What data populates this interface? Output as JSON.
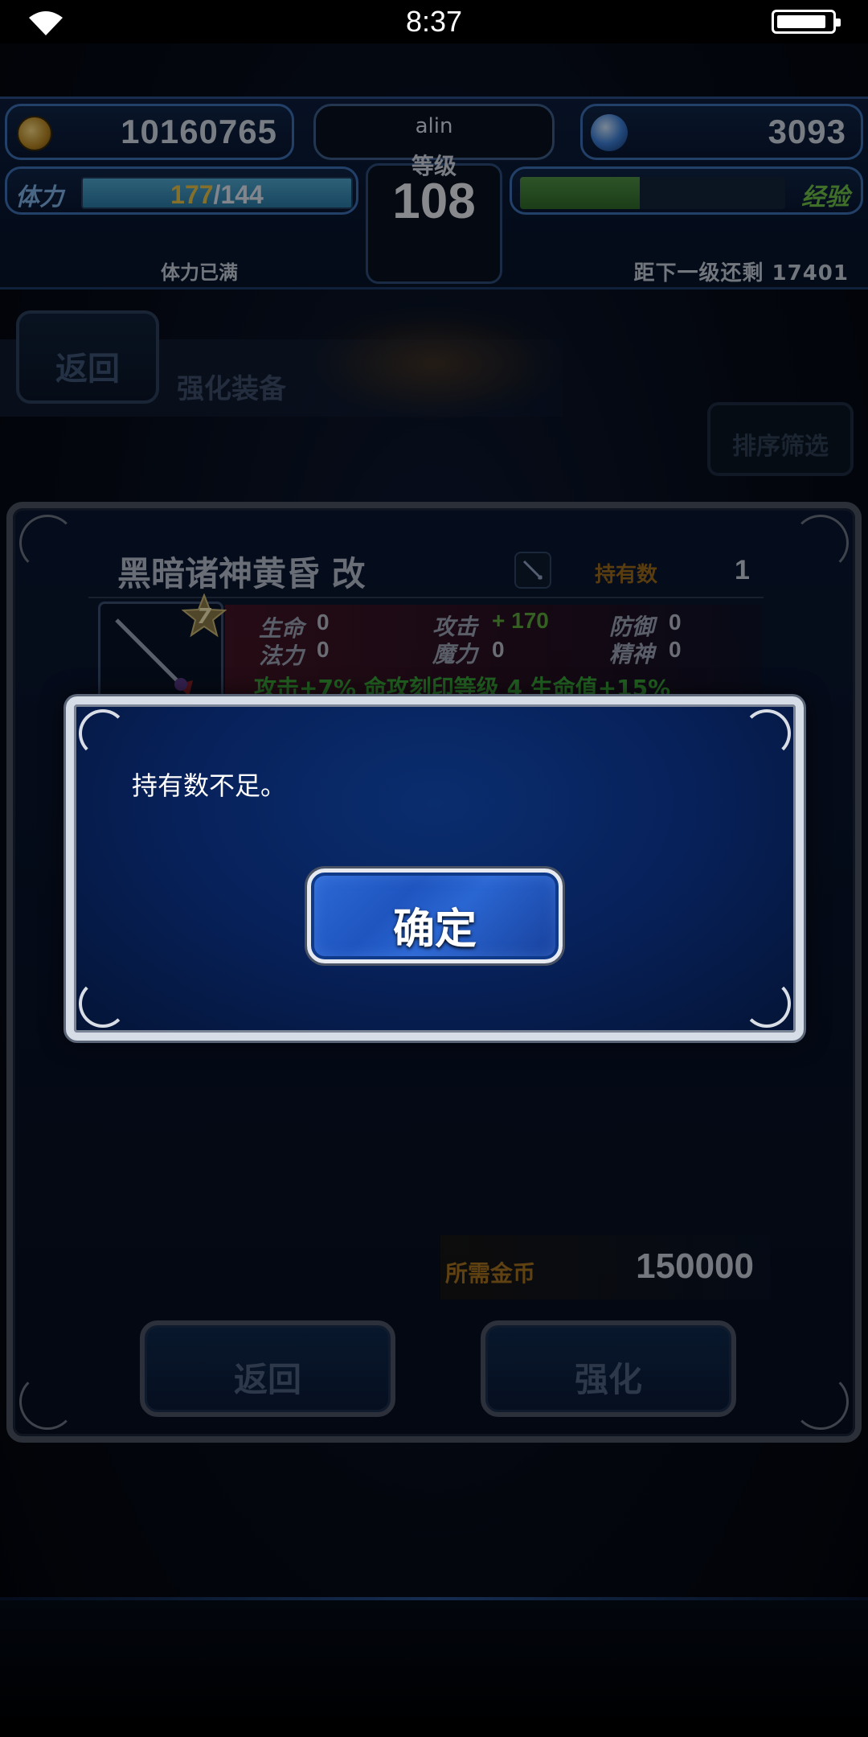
{
  "status_bar": {
    "time": "8:37"
  },
  "hud": {
    "gold": "10160765",
    "gems": "3093",
    "player_name": "alin",
    "level_label": "等级",
    "level": "108",
    "stamina_label": "体力",
    "stamina_current": "177",
    "stamina_max": "/144",
    "stamina_note": "体力已满",
    "exp_label": "经验",
    "exp_progress": 0.45,
    "exp_note": "距下一级还剩 17401"
  },
  "header": {
    "back_label": "返回",
    "title": "强化装备",
    "sort_label": "排序筛选"
  },
  "item": {
    "name": "黑暗诸神黄昏 改",
    "own_label": "持有数",
    "own_count": "1",
    "stars": "7",
    "stats": {
      "hp_label": "生命",
      "hp": "0",
      "atk_label": "攻击",
      "atk": "+ 170",
      "def_label": "防御",
      "def": "0",
      "mp_label": "法力",
      "mp": "0",
      "mag_label": "魔力",
      "mag": "0",
      "spr_label": "精神",
      "spr": "0"
    },
    "ability": "攻击+7% 命攻刻印等级 4 生命值+15%"
  },
  "cost": {
    "label": "所需金币",
    "value": "150000"
  },
  "buttons": {
    "back": "返回",
    "enhance": "强化"
  },
  "dialog": {
    "message": "持有数不足。",
    "ok": "确定"
  },
  "colors": {
    "accent_blue": "#2d6ad6",
    "gold_text": "#e5c24a",
    "exp_green": "#6fbf47",
    "bonus_green": "#3aa83a"
  }
}
